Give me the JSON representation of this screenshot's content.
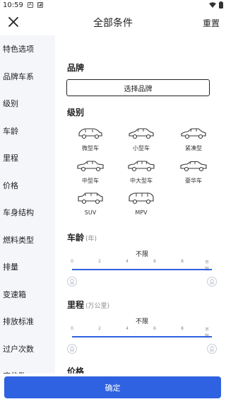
{
  "status_bar": {
    "time": "10:59"
  },
  "header": {
    "title": "全部条件",
    "reset_label": "重置"
  },
  "sidebar": {
    "items": [
      {
        "label": "特色选项"
      },
      {
        "label": "品牌车系"
      },
      {
        "label": "级别"
      },
      {
        "label": "车龄"
      },
      {
        "label": "里程"
      },
      {
        "label": "价格"
      },
      {
        "label": "车身结构"
      },
      {
        "label": "燃料类型"
      },
      {
        "label": "排量"
      },
      {
        "label": "变速箱"
      },
      {
        "label": "排放标准"
      },
      {
        "label": "过户次数"
      },
      {
        "label": "座位数"
      }
    ]
  },
  "brand": {
    "title": "品牌",
    "button_label": "选择品牌"
  },
  "level": {
    "title": "级别",
    "items": [
      {
        "label": "微型车",
        "icon": "mini-car-icon"
      },
      {
        "label": "小型车",
        "icon": "small-car-icon"
      },
      {
        "label": "紧凑型",
        "icon": "compact-car-icon"
      },
      {
        "label": "中型车",
        "icon": "midsize-car-icon"
      },
      {
        "label": "中大型车",
        "icon": "large-car-icon"
      },
      {
        "label": "豪华车",
        "icon": "luxury-car-icon"
      },
      {
        "label": "SUV",
        "icon": "suv-icon"
      },
      {
        "label": "MPV",
        "icon": "mpv-icon"
      }
    ]
  },
  "age": {
    "title": "车龄",
    "unit": "(年)",
    "value": "不限",
    "ticks": [
      "0",
      "2",
      "4",
      "6",
      "8",
      "不限"
    ]
  },
  "mileage": {
    "title": "里程",
    "unit": "(万公里)",
    "value": "不限",
    "ticks": [
      "0",
      "2",
      "4",
      "6",
      "8",
      "不限"
    ]
  },
  "price": {
    "title": "价格"
  },
  "footer": {
    "confirm_label": "确定"
  },
  "colors": {
    "accent": "#2f62e0",
    "sidebar_bg": "#f5f6fa"
  }
}
